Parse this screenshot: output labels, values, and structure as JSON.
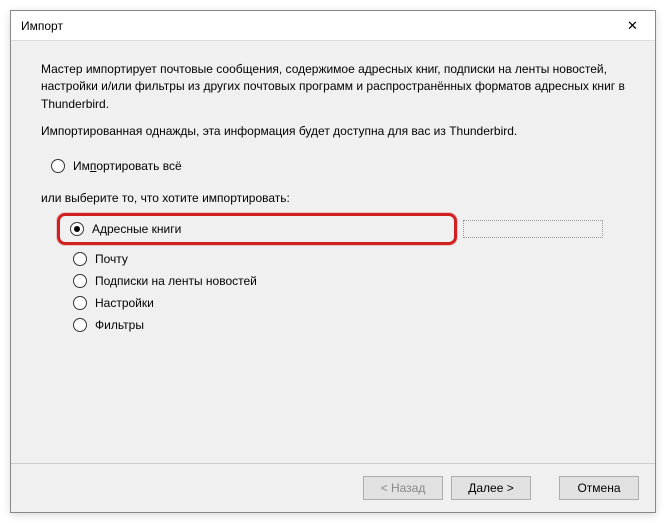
{
  "window": {
    "title": "Импорт"
  },
  "content": {
    "description1": "Мастер импортирует почтовые сообщения, содержимое адресных книг, подписки на ленты новостей, настройки и/или фильтры из других почтовых программ и распространённых форматов адресных книг в Thunderbird.",
    "description2": "Импортированная однажды, эта информация будет доступна для вас из Thunderbird.",
    "import_all_prefix": "Им",
    "import_all_hot": "п",
    "import_all_suffix": "ортировать всё",
    "or_select": "или выберите то, что хотите импортировать:",
    "options": {
      "address_books": "Адресные книги",
      "mail": "Почту",
      "feeds": "Подписки на ленты новостей",
      "settings": "Настройки",
      "filters": "Фильтры"
    }
  },
  "buttons": {
    "back": "< Назад",
    "next": "Далее >",
    "cancel": "Отмена"
  }
}
